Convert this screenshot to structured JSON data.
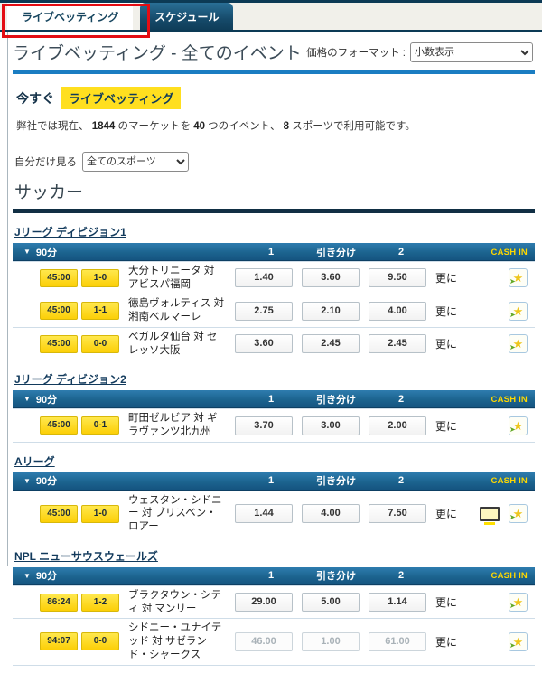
{
  "tabs": [
    {
      "label": "ライブベッティング",
      "active": true
    },
    {
      "label": "スケジュール",
      "active": false
    }
  ],
  "header": {
    "title": "ライブベッティング - 全てのイベント",
    "price_format_label": "価格のフォーマット :",
    "price_format_value": "小数表示"
  },
  "promo": {
    "now_label": "今すぐ",
    "live_button_label": "ライブベッティング"
  },
  "availability": {
    "part1": "弊社では現在、 ",
    "markets": "1844",
    "part2": " のマーケットを ",
    "events": "40",
    "part3": " つのイベント、 ",
    "sports": "8",
    "part4": " スポーツで利用可能です。"
  },
  "filter": {
    "label": "自分だけ見る",
    "value": "全てのスポーツ"
  },
  "sport_heading": "サッカー",
  "table_header": {
    "collapse_icon": "▼",
    "period": "90分",
    "col_home": "1",
    "col_draw": "引き分け",
    "col_away": "2",
    "cash_in": "CASH IN"
  },
  "more_label": "更に",
  "sections": [
    {
      "name": "Jリーグ ディビジョン1",
      "rows": [
        {
          "time": "45:00",
          "score": "1-0",
          "teams": "大分トリニータ 対 アビスパ福岡",
          "odds": [
            "1.40",
            "3.60",
            "9.50"
          ],
          "suspended": false,
          "has_tv": false
        },
        {
          "time": "45:00",
          "score": "1-1",
          "teams": "徳島ヴォルティス 対 湘南ベルマーレ",
          "odds": [
            "2.75",
            "2.10",
            "4.00"
          ],
          "suspended": false,
          "has_tv": false
        },
        {
          "time": "45:00",
          "score": "0-0",
          "teams": "ベガルタ仙台 対 セレッソ大阪",
          "odds": [
            "3.60",
            "2.45",
            "2.45"
          ],
          "suspended": false,
          "has_tv": false
        }
      ]
    },
    {
      "name": "Jリーグ ディビジョン2",
      "rows": [
        {
          "time": "45:00",
          "score": "0-1",
          "teams": "町田ゼルビア 対 ギラヴァンツ北九州",
          "odds": [
            "3.70",
            "3.00",
            "2.00"
          ],
          "suspended": false,
          "has_tv": false
        }
      ]
    },
    {
      "name": "Aリーグ",
      "rows": [
        {
          "time": "45:00",
          "score": "1-0",
          "teams": "ウェスタン・シドニー 対 ブリスベン・ロアー",
          "odds": [
            "1.44",
            "4.00",
            "7.50"
          ],
          "suspended": false,
          "has_tv": true
        }
      ]
    },
    {
      "name": "NPL ニューサウスウェールズ",
      "rows": [
        {
          "time": "86:24",
          "score": "1-2",
          "teams": "ブラクタウン・シティ 対 マンリー",
          "odds": [
            "29.00",
            "5.00",
            "1.14"
          ],
          "suspended": false,
          "has_tv": false
        },
        {
          "time": "94:07",
          "score": "0-0",
          "teams": "シドニー・ユナイテッド 対 サゼランド・シャークス",
          "odds": [
            "46.00",
            "1.00",
            "61.00"
          ],
          "suspended": true,
          "has_tv": false
        }
      ]
    }
  ],
  "icons": {
    "star": "★",
    "green_arrow": "➤",
    "tv": "live-stream-monitor"
  },
  "colors": {
    "navy": "#0c3a55",
    "accent_blue": "#1a7dc2",
    "bar_blue": "#1c648f",
    "badge_yellow": "#fccf07",
    "promo_yellow": "#ffdf1f",
    "cash_in_yellow": "#ffd800",
    "annotation_red": "#e30d13"
  }
}
